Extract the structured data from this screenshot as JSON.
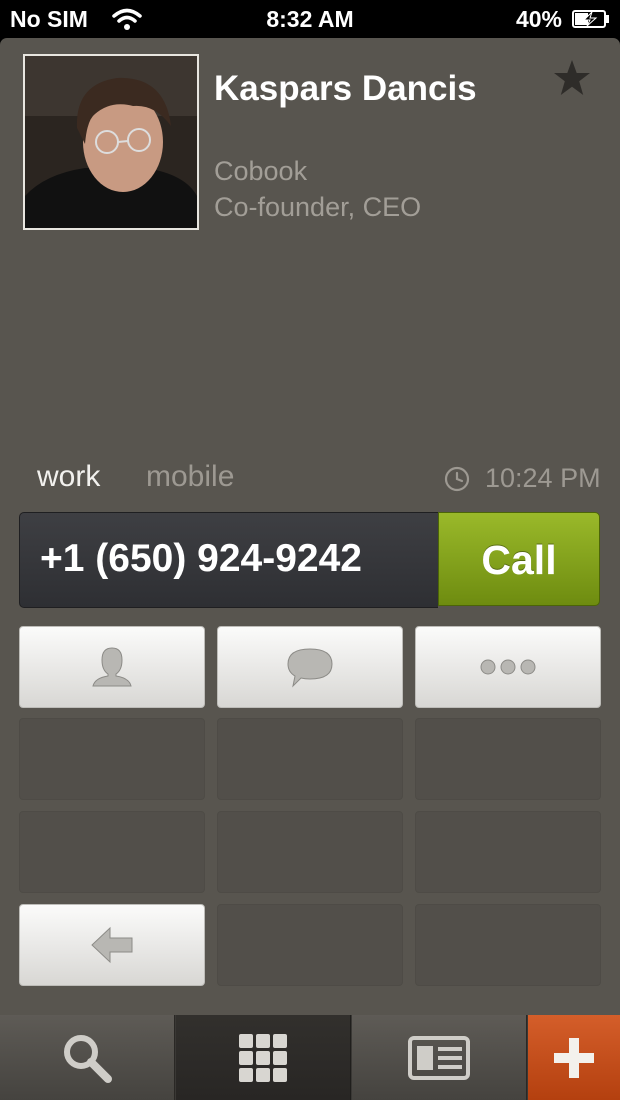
{
  "status_bar": {
    "carrier": "No SIM",
    "time": "8:32 AM",
    "battery": "40%",
    "wifi_icon": "wifi-icon",
    "battery_icon": "battery-charging-icon"
  },
  "contact": {
    "name": "Kaspars Dancis",
    "company": "Cobook",
    "title": "Co-founder, CEO",
    "favorite_icon": "star-icon"
  },
  "phone": {
    "labels": [
      "work",
      "mobile"
    ],
    "selected_label": "work",
    "last_call_time": "10:24 PM",
    "number": "+1 (650) 924-9242",
    "call_label": "Call"
  },
  "actions": [
    {
      "icon": "person-icon"
    },
    {
      "icon": "speech-bubble-icon"
    },
    {
      "icon": "more-dots-icon"
    }
  ],
  "back_icon": "back-arrow-icon",
  "tab_bar": [
    {
      "icon": "search-icon"
    },
    {
      "icon": "keypad-grid-icon",
      "selected": true
    },
    {
      "icon": "contact-card-icon"
    },
    {
      "icon": "plus-icon"
    }
  ],
  "colors": {
    "background": "#58554f",
    "call_green": "#8aab1e",
    "add_orange": "#c54c18",
    "secondary_text": "#a29e97"
  }
}
